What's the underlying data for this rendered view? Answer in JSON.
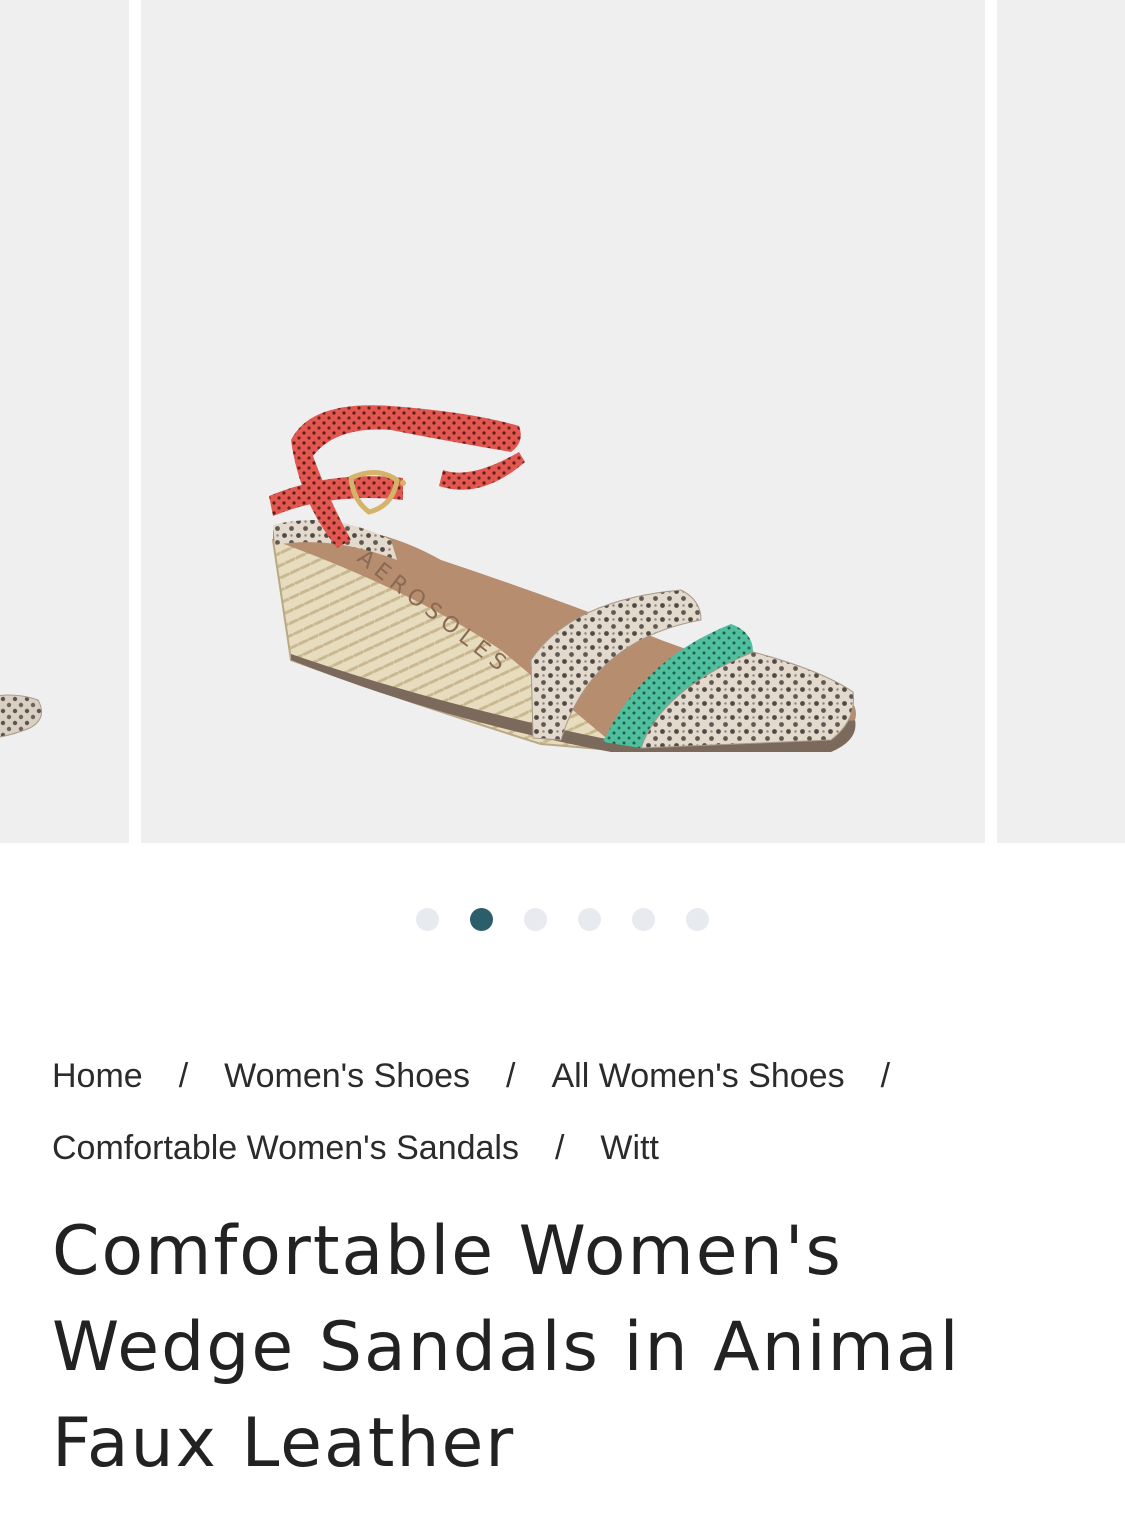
{
  "gallery": {
    "images": [
      {
        "name": "previous-product-image",
        "alt": "previous sandal view"
      },
      {
        "name": "main-product-image",
        "alt": "sandal side view",
        "brand_mark": "AEROSOLES"
      },
      {
        "name": "next-product-image",
        "alt": "next sandal view"
      }
    ],
    "zoom_icon": "search-icon",
    "pagination": {
      "count": 6,
      "active_index": 1
    },
    "colors": {
      "background": "#efefef",
      "dot_active": "#2a5e6b",
      "dot_inactive": "#e7eaee"
    }
  },
  "breadcrumb": {
    "items": [
      "Home",
      "Women's Shoes",
      "All Women's Shoes",
      "Comfortable Women's Sandals",
      "Witt"
    ],
    "separator": "/"
  },
  "product": {
    "title": "Comfortable Women's Wedge Sandals in Animal Faux Leather"
  }
}
